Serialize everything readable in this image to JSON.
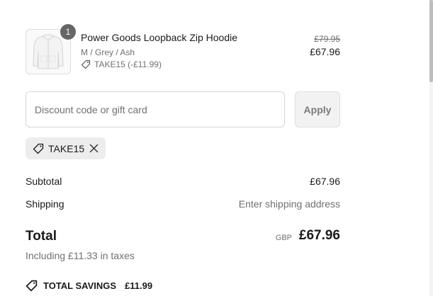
{
  "product": {
    "quantity": "1",
    "title": "Power Goods Loopback Zip Hoodie",
    "variant": "M / Grey / Ash",
    "discount_line": "TAKE15 (-£11.99)",
    "compare_price": "£79.95",
    "price": "£67.96",
    "image_icon": "hoodie-icon"
  },
  "discount": {
    "placeholder": "Discount code or gift card",
    "value": "",
    "apply_label": "Apply",
    "applied_code": "TAKE15",
    "tag_icon": "tag-icon",
    "remove_icon": "close-icon"
  },
  "summary": {
    "subtotal_label": "Subtotal",
    "subtotal_value": "£67.96",
    "shipping_label": "Shipping",
    "shipping_value": "Enter shipping address",
    "total_label": "Total",
    "currency": "GBP",
    "total_value": "£67.96",
    "taxes_text": "Including £11.33 in taxes",
    "savings_label": "TOTAL SAVINGS",
    "savings_value": "£11.99"
  },
  "colors": {
    "text": "#1a1a1a",
    "muted": "#707070",
    "badge": "#666666",
    "tag_bg": "#ededed",
    "button_bg": "#f2f2f2"
  }
}
